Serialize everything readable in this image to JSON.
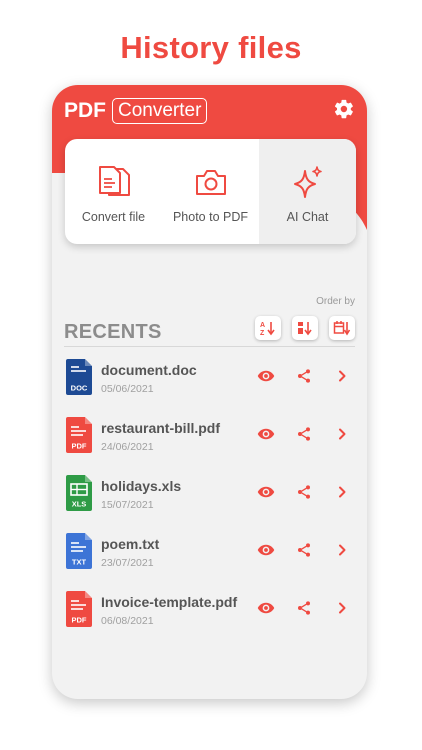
{
  "promo": {
    "title": "History files"
  },
  "app": {
    "title_pdf": "PDF",
    "title_converter": "Converter"
  },
  "actions": [
    {
      "label": "Convert file",
      "icon": "document-copy-icon"
    },
    {
      "label": "Photo to PDF",
      "icon": "camera-icon"
    },
    {
      "label": "AI Chat",
      "icon": "sparkles-icon",
      "active": true
    }
  ],
  "recents": {
    "heading": "RECENTS",
    "order_by": "Order by",
    "sort_icons": [
      "sort-alpha-icon",
      "sort-size-icon",
      "sort-date-icon"
    ]
  },
  "files": [
    {
      "name": "document.doc",
      "date": "05/06/2021",
      "type": "DOC",
      "color": "#1d4a94"
    },
    {
      "name": "restaurant-bill.pdf",
      "date": "24/06/2021",
      "type": "PDF",
      "color": "#ef4a41"
    },
    {
      "name": "holidays.xls",
      "date": "15/07/2021",
      "type": "XLS",
      "color": "#2e9b46"
    },
    {
      "name": "poem.txt",
      "date": "23/07/2021",
      "type": "TXT",
      "color": "#3d74d6"
    },
    {
      "name": "Invoice-template.pdf",
      "date": "06/08/2021",
      "type": "PDF",
      "color": "#ef4a41"
    }
  ],
  "colors": {
    "accent": "#ef4a41",
    "text": "#555555",
    "muted": "#a0a0a0"
  }
}
